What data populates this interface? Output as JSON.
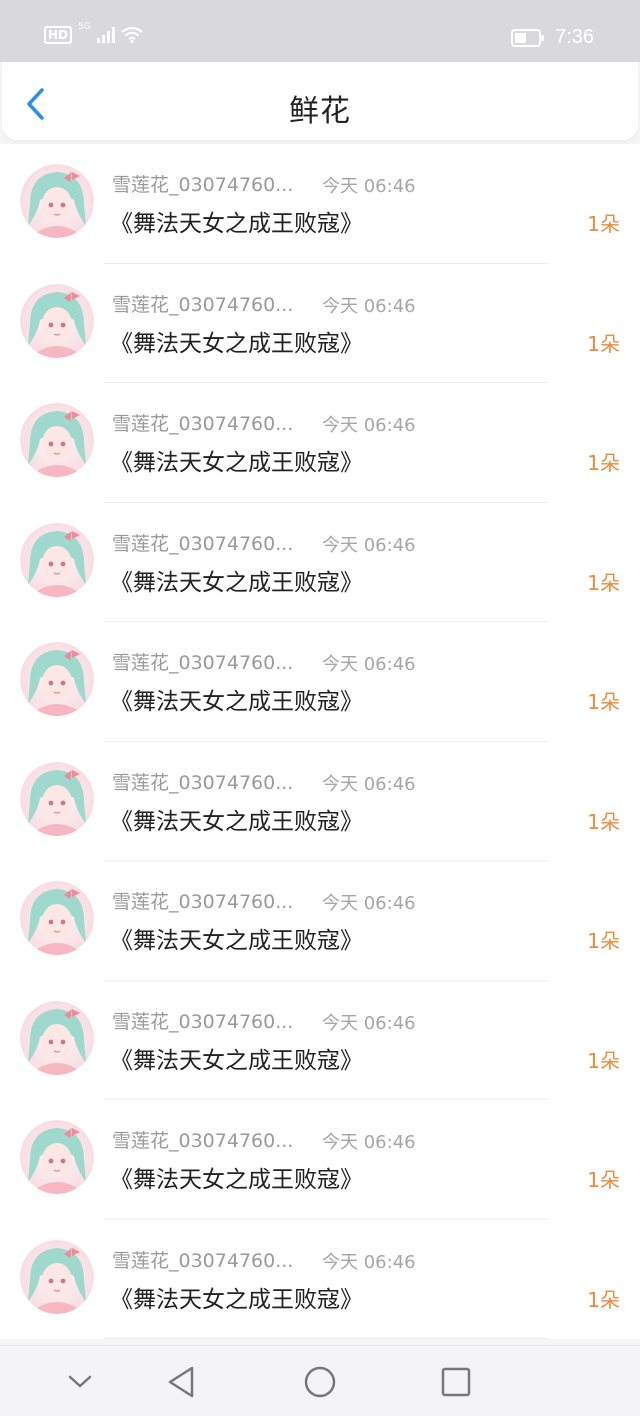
{
  "status_bar": {
    "hd": "HD",
    "network": "5G",
    "time": "7:36",
    "icons": [
      "signal-icon",
      "wifi-icon",
      "battery-icon"
    ]
  },
  "header": {
    "title": "鲜花",
    "back_icon": "chevron-left-icon"
  },
  "colors": {
    "accent_blue": "#2b8ee8",
    "count_orange": "#ee8a3a",
    "status_bar_bg": "#d9d9db"
  },
  "items": [
    {
      "user": "雪莲花_03074760...",
      "time": "今天 06:46",
      "book": "《舞法天女之成王败寇》",
      "count": "1朵"
    },
    {
      "user": "雪莲花_03074760...",
      "time": "今天 06:46",
      "book": "《舞法天女之成王败寇》",
      "count": "1朵"
    },
    {
      "user": "雪莲花_03074760...",
      "time": "今天 06:46",
      "book": "《舞法天女之成王败寇》",
      "count": "1朵"
    },
    {
      "user": "雪莲花_03074760...",
      "time": "今天 06:46",
      "book": "《舞法天女之成王败寇》",
      "count": "1朵"
    },
    {
      "user": "雪莲花_03074760...",
      "time": "今天 06:46",
      "book": "《舞法天女之成王败寇》",
      "count": "1朵"
    },
    {
      "user": "雪莲花_03074760...",
      "time": "今天 06:46",
      "book": "《舞法天女之成王败寇》",
      "count": "1朵"
    },
    {
      "user": "雪莲花_03074760...",
      "time": "今天 06:46",
      "book": "《舞法天女之成王败寇》",
      "count": "1朵"
    },
    {
      "user": "雪莲花_03074760...",
      "time": "今天 06:46",
      "book": "《舞法天女之成王败寇》",
      "count": "1朵"
    },
    {
      "user": "雪莲花_03074760...",
      "time": "今天 06:46",
      "book": "《舞法天女之成王败寇》",
      "count": "1朵"
    },
    {
      "user": "雪莲花_03074760...",
      "time": "今天 06:46",
      "book": "《舞法天女之成王败寇》",
      "count": "1朵"
    }
  ],
  "nav_bar": {
    "buttons": [
      "chevron-down-icon",
      "back-triangle-icon",
      "home-circle-icon",
      "recents-square-icon"
    ]
  }
}
